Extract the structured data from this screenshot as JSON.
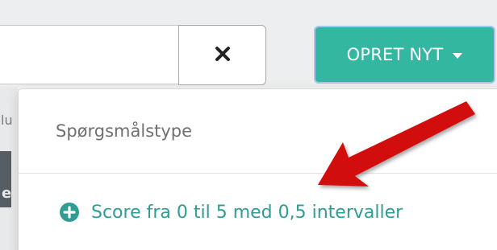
{
  "toolbar": {
    "search_value": "",
    "clear_label": "×",
    "create_label": "OPRET NYT"
  },
  "dropdown": {
    "header": "Spørgsmålstype",
    "items": [
      {
        "label": "Score fra 0 til 5 med 0,5 intervaller",
        "icon": "plus-circle-icon"
      }
    ]
  },
  "background": {
    "left_letter_1": "lu",
    "left_letter_2": "e"
  },
  "colors": {
    "accent": "#34b7a1",
    "link": "#2f9d92",
    "arrow": "#d10a0a"
  }
}
